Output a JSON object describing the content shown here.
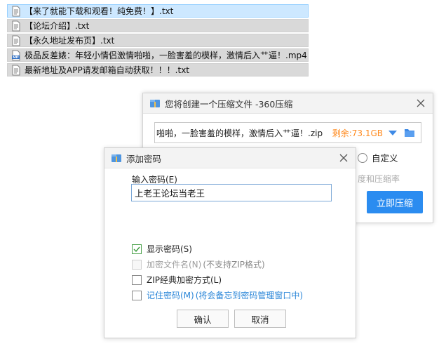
{
  "files": [
    {
      "name": "【来了就能下载和观看！纯免费！】.txt",
      "icon": "text-file-icon",
      "selected": true
    },
    {
      "name": "【论坛介绍】.txt",
      "icon": "text-file-icon",
      "selected": false
    },
    {
      "name": "【永久地址发布页】.txt",
      "icon": "text-file-icon",
      "selected": false
    },
    {
      "name": "极品反差婊：年轻小情侣激情啪啪，一脸害羞的模样，激情后入艹逼！.mp4",
      "icon": "mp4-file-icon",
      "selected": false
    },
    {
      "name": "最新地址及APP请发邮箱自动获取！！！.txt",
      "icon": "text-file-icon",
      "selected": false
    }
  ],
  "zip_dialog": {
    "title": "您将创建一个压缩文件 -360压缩",
    "path": "啪啪，一脸害羞的模样，激情后入艹逼！.zip",
    "free_space": "剩余:73.1GB",
    "custom_label": "自定义",
    "partial_text": "度和压缩率",
    "compress_button": "立即压缩"
  },
  "password_dialog": {
    "title": "添加密码",
    "field_label": "输入密码(E)",
    "password_value": "上老王论坛当老王",
    "options": {
      "show_password": {
        "label": "显示密码(S)",
        "checked": true
      },
      "encrypt_filename": {
        "label": "加密文件名(N)",
        "note": "(不支持ZIP格式)",
        "enabled": false
      },
      "zip_classic": {
        "label": "ZIP经典加密方式(L)",
        "checked": false
      },
      "remember": {
        "label": "记住密码(M)",
        "note": "(将会备忘到密码管理窗口中)",
        "checked": false
      }
    },
    "ok_button": "确认",
    "cancel_button": "取消"
  },
  "colors": {
    "accent": "#2b8cf0",
    "free_space": "#ff8a1e",
    "link": "#2a86d8",
    "selected_row": "#cde8ff"
  }
}
